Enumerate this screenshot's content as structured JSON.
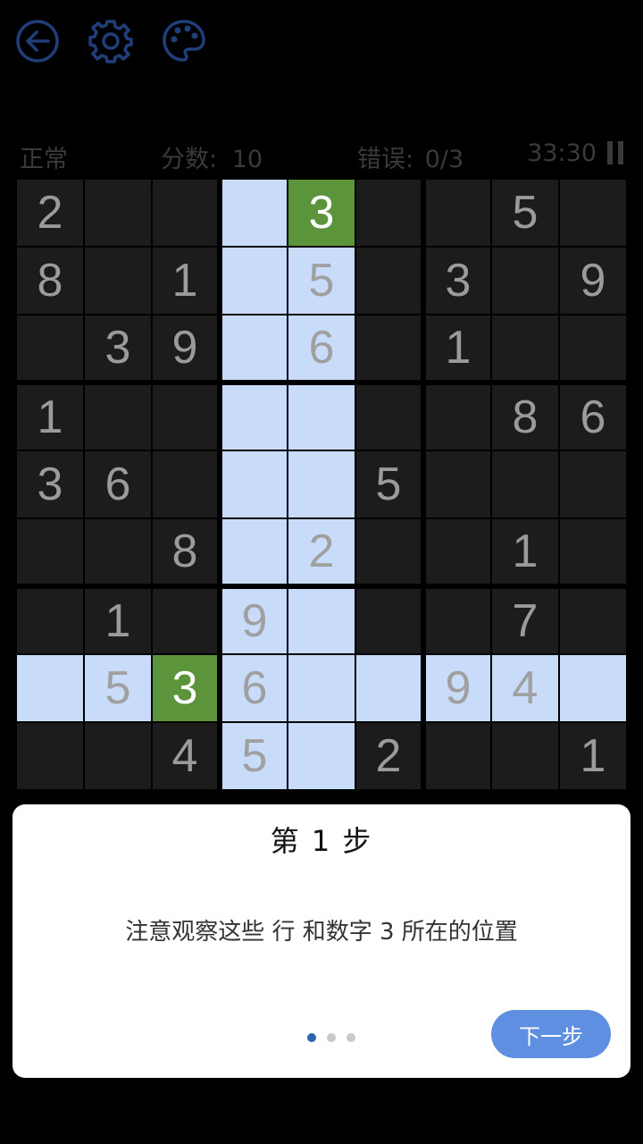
{
  "toolbar": {
    "icons": [
      "back-arrow-icon",
      "gear-icon",
      "palette-icon"
    ],
    "icon_color": "#1f3e7a"
  },
  "status": {
    "difficulty": "正常",
    "score_label": "分数:",
    "score": "10",
    "errors_label": "错误:",
    "errors": "0/3",
    "time": "33:30",
    "pause_icon": "pause-icon"
  },
  "board": {
    "cells": [
      [
        "2",
        "",
        "",
        "",
        "3",
        "",
        "",
        "5",
        ""
      ],
      [
        "8",
        "",
        "1",
        "",
        "5",
        "",
        "3",
        "",
        "9"
      ],
      [
        "",
        "3",
        "9",
        "",
        "6",
        "",
        "1",
        "",
        ""
      ],
      [
        "1",
        "",
        "",
        "",
        "",
        "",
        "",
        "8",
        "6"
      ],
      [
        "3",
        "6",
        "",
        "",
        "",
        "5",
        "",
        "",
        ""
      ],
      [
        "",
        "",
        "8",
        "",
        "2",
        "",
        "",
        "1",
        ""
      ],
      [
        "",
        "1",
        "",
        "9",
        "",
        "",
        "",
        "7",
        ""
      ],
      [
        "",
        "5",
        "3",
        "6",
        "",
        "",
        "9",
        "4",
        ""
      ],
      [
        "",
        "",
        "4",
        "5",
        "",
        "2",
        "",
        "",
        "1"
      ]
    ],
    "highlighted_row": 7,
    "highlighted_columns": [
      3,
      4
    ],
    "highlighted_rows_in_columns": {
      "3": [
        0,
        1,
        2,
        3,
        4,
        5,
        6,
        7,
        8
      ],
      "4": [
        1,
        2,
        3,
        4,
        5,
        6,
        7,
        8
      ]
    },
    "target_cells": [
      [
        0,
        4
      ],
      [
        7,
        2
      ]
    ],
    "colors": {
      "cell": "#1c1c1c",
      "digit": "#9b9b9b",
      "highlight": "#c8dbf8",
      "target": "#5b943b"
    }
  },
  "tutorial": {
    "title": "第 1 步",
    "message": "注意观察这些 行 和数字 3 所在的位置",
    "page_count": 3,
    "current_page": 0,
    "next_label": "下一步",
    "button_color": "#5f8fe0"
  }
}
